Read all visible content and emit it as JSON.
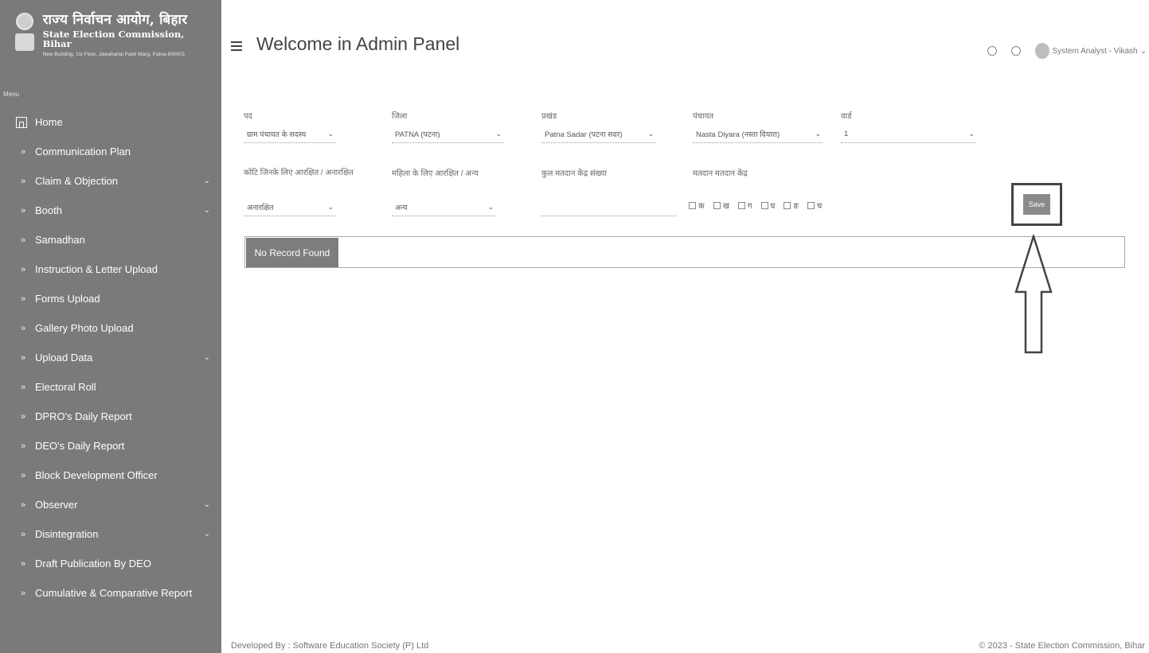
{
  "brand": {
    "title_hi": "राज्य निर्वाचन आयोग, बिहार",
    "title_en": "State Election Commission, Bihar",
    "address": "New Building, 1st Floor, Jawaharlal Patel Marg, Patna-800001"
  },
  "sidebar": {
    "heading": "Menu",
    "items": [
      {
        "label": "Home",
        "icon": "home-icon",
        "expandable": false
      },
      {
        "label": "Communication Plan",
        "expandable": false
      },
      {
        "label": "Claim & Objection",
        "expandable": true
      },
      {
        "label": "Booth",
        "expandable": true
      },
      {
        "label": "Samadhan",
        "expandable": false
      },
      {
        "label": "Instruction & Letter Upload",
        "expandable": false
      },
      {
        "label": "Forms Upload",
        "expandable": false
      },
      {
        "label": "Gallery Photo Upload",
        "expandable": false
      },
      {
        "label": "Upload Data",
        "expandable": true
      },
      {
        "label": "Electoral Roll",
        "expandable": false
      },
      {
        "label": "DPRO's Daily Report",
        "expandable": false
      },
      {
        "label": "DEO's Daily Report",
        "expandable": false
      },
      {
        "label": "Block Development Officer",
        "expandable": false
      },
      {
        "label": "Observer",
        "expandable": true
      },
      {
        "label": "Disintegration",
        "expandable": true
      },
      {
        "label": "Draft Publication By DEO",
        "expandable": false
      },
      {
        "label": "Cumulative & Comparative Report",
        "expandable": false
      }
    ]
  },
  "header": {
    "title": "Welcome in Admin Panel",
    "user": "System Analyst - Vikash"
  },
  "filters": {
    "row1": [
      {
        "label": "पद",
        "value": "ग्राम पंचायत के सदस्य"
      },
      {
        "label": "जिला",
        "value": "PATNA (पटना)"
      },
      {
        "label": "प्रखंड",
        "value": "Patna Sadar (पटना सदर)"
      },
      {
        "label": "पंचायत",
        "value": "Nasta Diyara (नस्ता दियारा)"
      },
      {
        "label": "वार्ड",
        "value": "1"
      }
    ],
    "row2": [
      {
        "label": "कोटि जिनके लिए आरक्षित / अनारक्षित",
        "value": "अनारक्षित"
      },
      {
        "label": "महिला के लिए आरक्षित / अन्य",
        "value": "अन्य"
      },
      {
        "label": "कुल मतदान केंद्र संख्या",
        "value": ""
      },
      {
        "label": "मतदान मतदान केंद्र",
        "value": ""
      }
    ],
    "checks": [
      "क",
      "ख",
      "ग",
      "घ",
      "ङ",
      "च"
    ],
    "save_label": "Save"
  },
  "results": {
    "empty_label": "No Record Found"
  },
  "footer": {
    "left": "Developed By : Software Education Society (P) Ltd",
    "right": "© 2023 - State Election Commission, Bihar"
  }
}
